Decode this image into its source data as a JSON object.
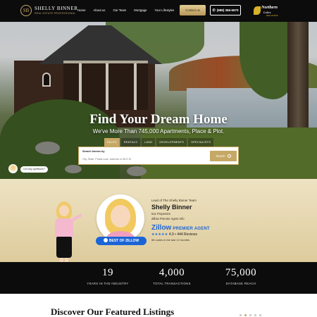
{
  "header": {
    "logo_mark": "SB",
    "logo_name": "SHELLY BINNER",
    "logo_tagline": "REAL ESTATE PROFESSIONAL",
    "nav": [
      "Home",
      "About us",
      "Our Team",
      "Mortgage",
      "Your Lifestyles",
      "Careers"
    ],
    "contact_label": "Contact us",
    "phone_label": "(888) 366-5970",
    "partner_logo": {
      "line1": "Northern",
      "line2": "Lakes",
      "line3": "REAL ESTATE"
    }
  },
  "hero": {
    "title": "Find Your Dream Home",
    "subtitle": "We've More Than 745,000 Apartments, Place & Plot.",
    "tabs": [
      "SALES",
      "RENTALS",
      "LAND",
      "DEVELOPMENTS",
      "SPECIALISTS"
    ],
    "active_tab": "SALES",
    "search": {
      "label": "Search homes by",
      "placeholder": "City, State, Postal code, Address or MLS ID",
      "button_label": "Search"
    }
  },
  "chat": {
    "bubble_text": "Got any questions?"
  },
  "agent": {
    "role": "Lead of The Shelly Binner Team",
    "name": "Shelly Binner",
    "properties": "511 Properties",
    "zillow_info": "Zillow Premier Agent Info",
    "zillow_word": "Zillow",
    "premier_label": "PREMIER AGENT",
    "stars": "★★★★★",
    "rating": "4.9",
    "reviews": "444 Reviews",
    "sales": "5th sales in the last 12 months",
    "badge": "BEST OF ZILLOW"
  },
  "stats": [
    {
      "number": "19",
      "label": "YEARS IN THE INDUSTRY"
    },
    {
      "number": "4,000",
      "label": "TOTAL TRANSACTIONS"
    },
    {
      "number": "75,000",
      "label": "DATABASE REACH"
    }
  ],
  "featured": {
    "title": "Discover Our Featured Listings",
    "dots_count": 5,
    "active_dot": 1
  },
  "colors": {
    "gold": "#c6a865",
    "black": "#0c0c0c",
    "zillow_blue": "#1b64d6",
    "agent_bg": "#e5d6ae"
  }
}
